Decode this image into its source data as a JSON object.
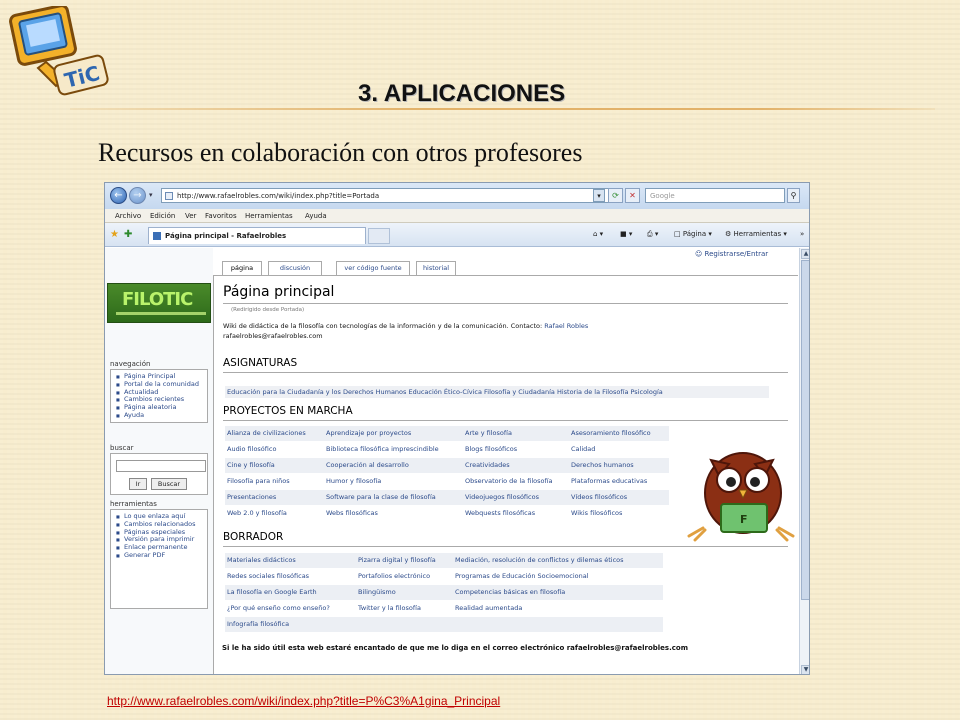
{
  "slide": {
    "title": "3. APLICACIONES",
    "subtitle": "Recursos en colaboración con otros profesores",
    "logo_text": "TiC",
    "source_link": "http://www.rafaelrobles.com/wiki/index.php?title=P%C3%A1gina_Principal"
  },
  "browser": {
    "address": "http://www.rafaelrobles.com/wiki/index.php?title=Portada",
    "search_placeholder": "Google",
    "menu": [
      "Archivo",
      "Edición",
      "Ver",
      "Favoritos",
      "Herramientas",
      "Ayuda"
    ],
    "tab_title": "Página principal - Rafaelrobles",
    "tools": {
      "page": "Página",
      "tools": "Herramientas"
    }
  },
  "wiki": {
    "user_link": "Registrarse/Entrar",
    "tabs": [
      "página",
      "discusión",
      "ver código fuente",
      "historial"
    ],
    "logo_text": "FILOTIC",
    "navigation_title": "navegación",
    "navigation": [
      "Página Principal",
      "Portal de la comunidad",
      "Actualidad",
      "Cambios recientes",
      "Página aleatoria",
      "Ayuda"
    ],
    "search_title": "buscar",
    "search_go": "Ir",
    "search_button": "Buscar",
    "tools_title": "herramientas",
    "tools": [
      "Lo que enlaza aquí",
      "Cambios relacionados",
      "Páginas especiales",
      "Versión para imprimir",
      "Enlace permanente",
      "Generar PDF"
    ],
    "page_title": "Página principal",
    "redirect_note": "(Redirigido desde Portada)",
    "intro": "Wiki de didáctica de la filosofía con tecnologías de la información y de la comunicación. Contacto:",
    "contact_name": "Rafael Robles",
    "contact_email": "rafaelrobles@rafaelrobles.com",
    "asignaturas_heading": "ASIGNATURAS",
    "asignaturas": "Educación para la Ciudadanía y los Derechos Humanos Educación Ético-Cívica Filosofía y Ciudadanía Historia de la Filosofía Psicología",
    "proyectos_heading": "PROYECTOS EN MARCHA",
    "proyectos": [
      [
        "Alianza de civilizaciones",
        "Aprendizaje por proyectos",
        "Arte y filosofía",
        "Asesoramiento filosófico"
      ],
      [
        "Audio filosófico",
        "Biblioteca filosófica imprescindible",
        "Blogs filosóficos",
        "Calidad"
      ],
      [
        "Cine y filosofía",
        "Cooperación al desarrollo",
        "Creatividades",
        "Derechos humanos"
      ],
      [
        "Filosofía para niños",
        "Humor y filosofía",
        "Observatorio de la filosofía",
        "Plataformas educativas"
      ],
      [
        "Presentaciones",
        "Software para la clase de filosofía",
        "Videojuegos filosóficos",
        "Vídeos filosóficos"
      ],
      [
        "Web 2.0 y filosofía",
        "Webs filosóficas",
        "Webquests filosóficas",
        "Wikis filosóficos"
      ]
    ],
    "borrador_heading": "BORRADOR",
    "borrador": [
      [
        "Materiales didácticos",
        "Pizarra digital y filosofía",
        "Mediación, resolución de conflictos y dilemas éticos"
      ],
      [
        "Redes sociales filosóficas",
        "Portafolios electrónico",
        "Programas de Educación Socioemocional"
      ],
      [
        "La filosofía en Google Earth",
        "Bilingüismo",
        "Competencias básicas en filosofía"
      ],
      [
        "¿Por qué enseño como enseño?",
        "Twitter y la filosofía",
        "Realidad aumentada"
      ],
      [
        "Infografía filosófica",
        "",
        ""
      ]
    ],
    "footer": "Si le ha sido útil esta web estaré encantado de que me lo diga en el correo electrónico rafaelrobles@rafaelrobles.com",
    "mascot_label": "F"
  },
  "colors": {
    "slide_bg": "#f8edcf",
    "rule": "#e2b26a",
    "link": "#2b4a8a",
    "source_link": "#c00000"
  }
}
